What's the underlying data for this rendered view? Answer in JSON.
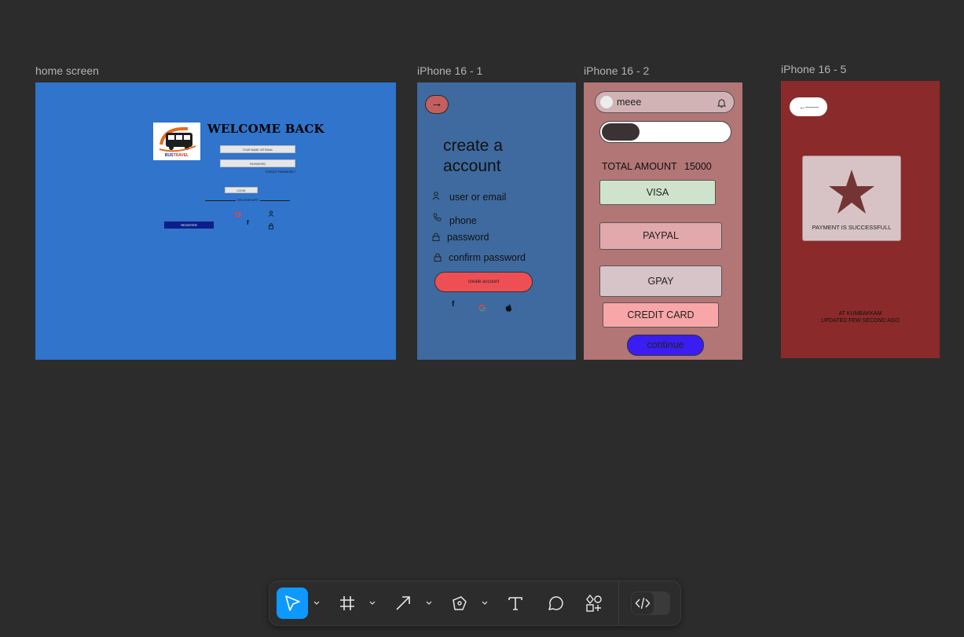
{
  "canvas": {
    "frames": [
      {
        "label": "home screen"
      },
      {
        "label": "iPhone 16 - 1"
      },
      {
        "label": "iPhone 16 - 2"
      },
      {
        "label": "iPhone 16 - 5"
      }
    ]
  },
  "home": {
    "title": "WELCOME BACK",
    "logo_text_a": "BUS",
    "logo_text_b": "TRAVEL",
    "username_placeholder": "YOUR NAME OR EMAIL",
    "password_placeholder": "PASSWORD",
    "forgot": "FORGOT PASSWORD ?",
    "login": "LOGIN",
    "or_login_with": "OR LOGIN WITH",
    "register": "REGISTER"
  },
  "iphone1": {
    "title_line1": "create a",
    "title_line2": "account",
    "user_label": "user or email",
    "phone_label": "phone",
    "password_label": "password",
    "confirm_label": "confirm password",
    "create_button": "create account",
    "next_icon": "→"
  },
  "iphone2": {
    "user_name": "meee",
    "total_label": "TOTAL AMOUNT",
    "total_value": "15000",
    "visa": "VISA",
    "paypal": "PAYPAL",
    "gpay": "GPAY",
    "credit_card": "CREDIT CARD",
    "continue": "continue",
    "colors": {
      "visa_bg": "#cfe3cc",
      "paypal_bg": "#e2a9ad",
      "gpay_bg": "#d7c4c8",
      "credit_bg": "#f9a6a9",
      "continue_bg": "#3a1df0"
    }
  },
  "iphone5": {
    "back_icon": "←——",
    "payment_text": "PAYMENT IS SUCCESSFULL",
    "location_line1": "AT KUMBAKKAM",
    "location_line2": "UPDATED FEW SECOND AGO"
  },
  "toolbar": {
    "tools": [
      "move-tool",
      "frame-tool",
      "arrow-tool",
      "pen-tool",
      "text-tool",
      "comment-tool",
      "shapes-tool",
      "dev-mode-toggle"
    ],
    "active_tool": "move-tool",
    "active_color": "#0d99ff"
  }
}
